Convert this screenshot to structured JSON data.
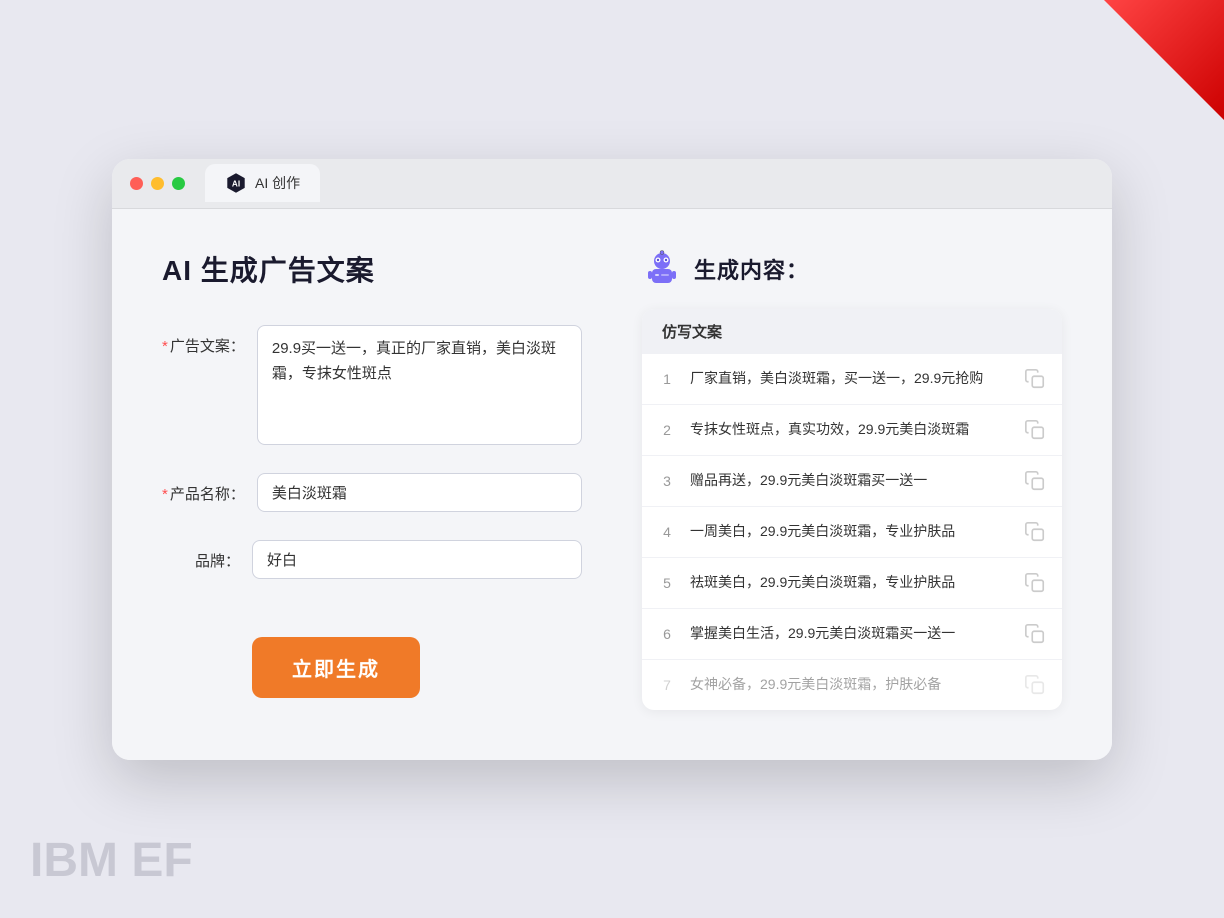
{
  "window": {
    "tab_label": "AI 创作"
  },
  "page": {
    "title": "AI 生成广告文案"
  },
  "form": {
    "ad_copy_label": "广告文案：",
    "ad_copy_required": "*",
    "ad_copy_value": "29.9买一送一，真正的厂家直销，美白淡斑霜，专抹女性斑点",
    "product_name_label": "产品名称：",
    "product_name_required": "*",
    "product_name_value": "美白淡斑霜",
    "brand_label": "品牌：",
    "brand_value": "好白",
    "generate_button": "立即生成"
  },
  "result": {
    "title": "生成内容：",
    "table_header": "仿写文案",
    "rows": [
      {
        "num": "1",
        "text": "厂家直销，美白淡斑霜，买一送一，29.9元抢购",
        "dimmed": false
      },
      {
        "num": "2",
        "text": "专抹女性斑点，真实功效，29.9元美白淡斑霜",
        "dimmed": false
      },
      {
        "num": "3",
        "text": "赠品再送，29.9元美白淡斑霜买一送一",
        "dimmed": false
      },
      {
        "num": "4",
        "text": "一周美白，29.9元美白淡斑霜，专业护肤品",
        "dimmed": false
      },
      {
        "num": "5",
        "text": "祛斑美白，29.9元美白淡斑霜，专业护肤品",
        "dimmed": false
      },
      {
        "num": "6",
        "text": "掌握美白生活，29.9元美白淡斑霜买一送一",
        "dimmed": false
      },
      {
        "num": "7",
        "text": "女神必备，29.9元美白淡斑霜，护肤必备",
        "dimmed": true
      }
    ]
  },
  "decorative": {
    "ibm_ef_text": "IBM EF"
  }
}
